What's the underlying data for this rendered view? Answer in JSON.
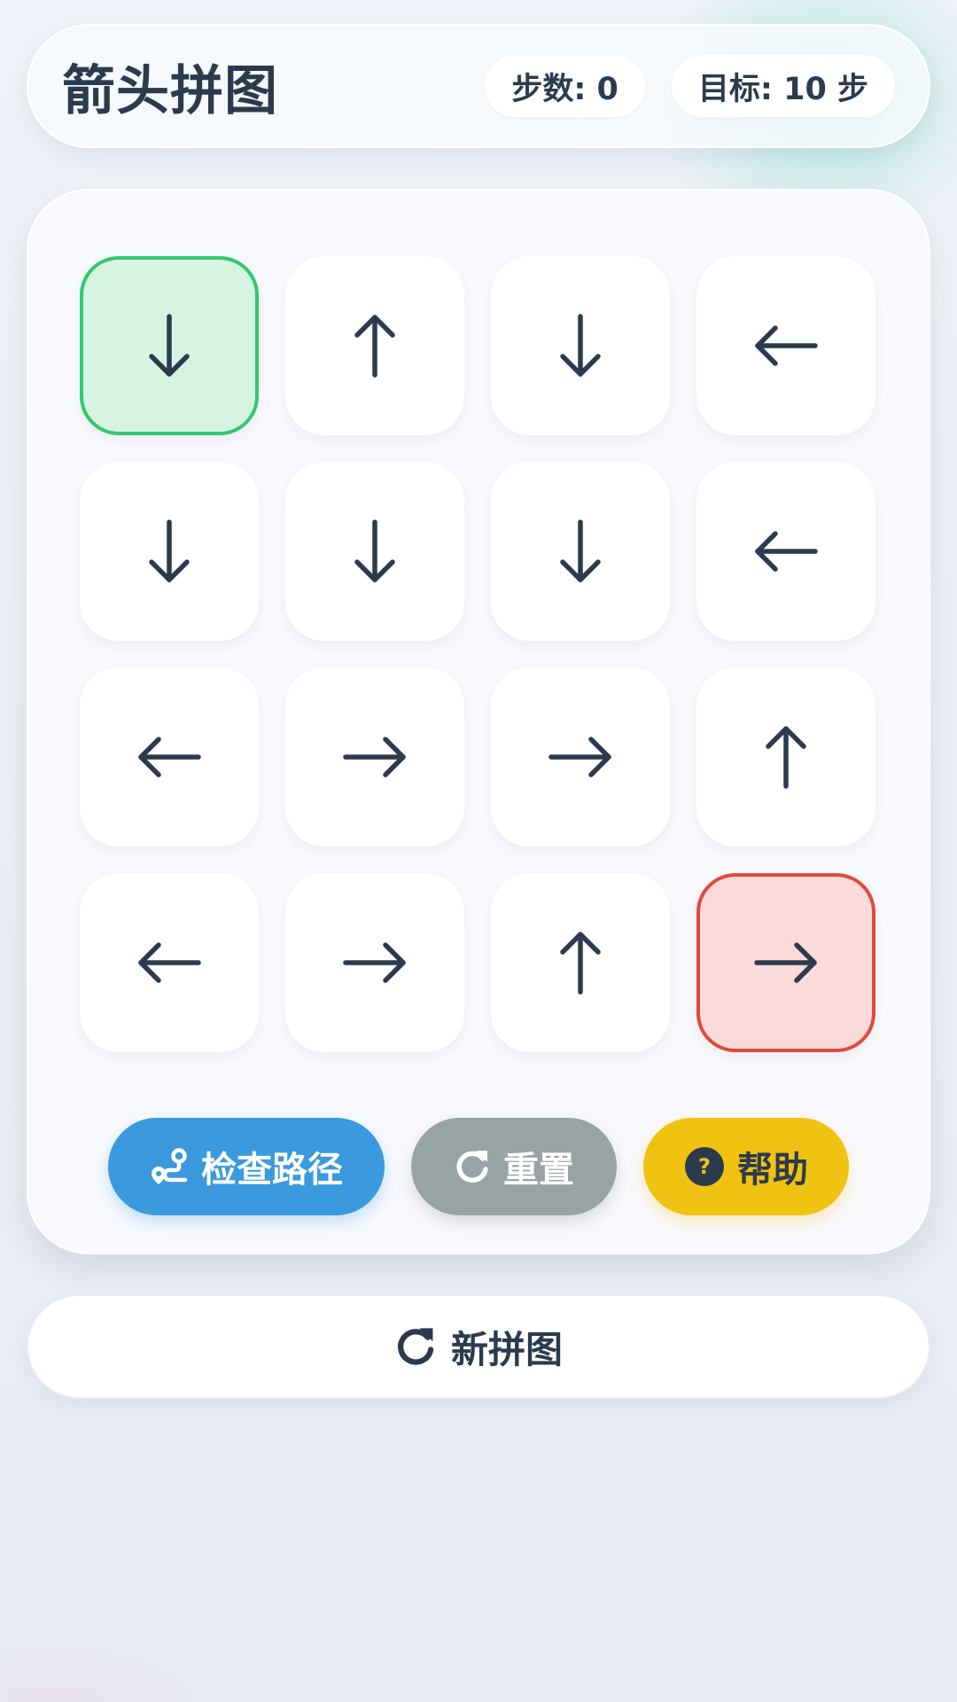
{
  "header": {
    "title": "箭头拼图",
    "steps_label": "步数: 0",
    "target_label": "目标: 10 步"
  },
  "board": {
    "tiles": [
      {
        "dir": "down",
        "state": "start"
      },
      {
        "dir": "up",
        "state": "normal"
      },
      {
        "dir": "down",
        "state": "normal"
      },
      {
        "dir": "left",
        "state": "normal"
      },
      {
        "dir": "down",
        "state": "normal"
      },
      {
        "dir": "down",
        "state": "normal"
      },
      {
        "dir": "down",
        "state": "normal"
      },
      {
        "dir": "left",
        "state": "normal"
      },
      {
        "dir": "left",
        "state": "normal"
      },
      {
        "dir": "right",
        "state": "normal"
      },
      {
        "dir": "right",
        "state": "normal"
      },
      {
        "dir": "up",
        "state": "normal"
      },
      {
        "dir": "left",
        "state": "normal"
      },
      {
        "dir": "right",
        "state": "normal"
      },
      {
        "dir": "up",
        "state": "normal"
      },
      {
        "dir": "right",
        "state": "end"
      }
    ]
  },
  "actions": {
    "check_label": "检查路径",
    "check_icon": "route-icon",
    "reset_label": "重置",
    "reset_icon": "rotate-icon",
    "help_label": "帮助",
    "help_icon": "question-circle-icon"
  },
  "new_puzzle": {
    "label": "新拼图",
    "icon": "rotate-icon"
  },
  "colors": {
    "text": "#2c3a4e",
    "start_fill": "#d6f4e1",
    "start_border": "#34c76e",
    "end_fill": "#fadbd9",
    "end_border": "#e04a3c",
    "check_button": "#3a9add",
    "reset_button": "#97a3a5",
    "help_button": "#f0c211"
  }
}
